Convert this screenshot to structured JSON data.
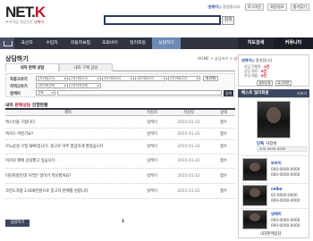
{
  "header": {
    "logo_main": "NET",
    "logo_k": "K",
    "logo_sub_prefix": "프리미엄 영업추천",
    "logo_sub_red": "넷케이",
    "user_name": "넷케이",
    "user_suffix": "님 환영합니다.",
    "top_buttons": [
      "로그아웃",
      "회원정보",
      "즐겨찾기"
    ],
    "search_button": "검색",
    "search_value": ""
  },
  "nav": {
    "items": [
      "국산차",
      "수입차",
      "자동차보험",
      "오토바이",
      "딜러회원",
      "상담하기"
    ],
    "active_index": 5,
    "right_items": [
      "지도검색",
      "커뮤니티"
    ]
  },
  "page": {
    "title": "상담하기",
    "breadcrumb": [
      "HOME",
      "상담하기",
      "상담하기"
    ],
    "subtabs": [
      "내차 판매 상담",
      "내차 구매 상담"
    ],
    "filter": {
      "label_brand": "차종고르기",
      "label_region": "지역고르기",
      "label_search": "검색어",
      "brand_selects": [
        "1차카테고리",
        "2차카테고리",
        "3차카테고리",
        "4차카테고리",
        "5차카테고리"
      ],
      "region_selects": [
        "1차지역선택",
        "2차지역선택"
      ],
      "search_select": "선택",
      "search_button": "검색",
      "reset_button": "초기화"
    },
    "section_prefix": "내차",
    "section_red": "판매상담",
    "section_suffix": "진행현황",
    "table": {
      "headers": [
        "제목",
        "작성자",
        "작성일",
        "상태"
      ],
      "rows": [
        {
          "title": "렉스턴을 구합니다",
          "writer": "넷케이",
          "date": "2015-01-22",
          "state": "접수"
        },
        {
          "title": "렉서스 어떤가요?",
          "writer": "넷케이",
          "date": "2015-01-22",
          "state": "접수"
        },
        {
          "title": "르노삼성 구형 SM5입니다. 중고로 아주 깔끔하게 팔았습니다.",
          "writer": "넷케이",
          "date": "2015-01-22",
          "state": "접수"
        },
        {
          "title": "저가의 매매 상담했고 싶습니다.",
          "writer": "넷케이",
          "date": "2015-01-22",
          "state": "접수"
        },
        {
          "title": "이런차량인데 가격은 얼마가 적당할까요?",
          "writer": "넷케이",
          "date": "2015-01-22",
          "state": "접수"
        },
        {
          "title": "코란도차량 2,000만원으로 중고차 판매를 원합니다",
          "writer": "넷케이",
          "date": "2015-01-22",
          "state": "접수"
        }
      ]
    },
    "write_button": "상담하기",
    "pager_current": "1"
  },
  "sidebar": {
    "greet_user": "넷케이",
    "greet_suffix": "님 환영합니다",
    "info_lines": [
      {
        "label": "상담 진행중 :",
        "value": "0건"
      },
      {
        "label": "상담 완료 :",
        "value": "0건"
      },
      {
        "label": "관심 매물 :",
        "value": "0건"
      }
    ],
    "buttons": [
      "정보수정",
      "로그아웃"
    ],
    "best_title": "베스트 딜러회원",
    "best_more": "더보기",
    "featured": {
      "tag": "단독",
      "name": "사장비",
      "phone": "000-0000-0000"
    },
    "members": [
      {
        "tag": "보자이",
        "name": "",
        "phone": "000-0000-0000",
        "phone2": "000-0000-0000"
      },
      {
        "tag": "celba",
        "name": "",
        "phone": "02-0000-0000",
        "phone2": "000-0000-0000"
      },
      {
        "tag": "넷케이",
        "name": "",
        "phone": "000-0000-0000",
        "phone2": "000-0000-0000"
      }
    ],
    "bottom_link": "내차판매상담"
  }
}
